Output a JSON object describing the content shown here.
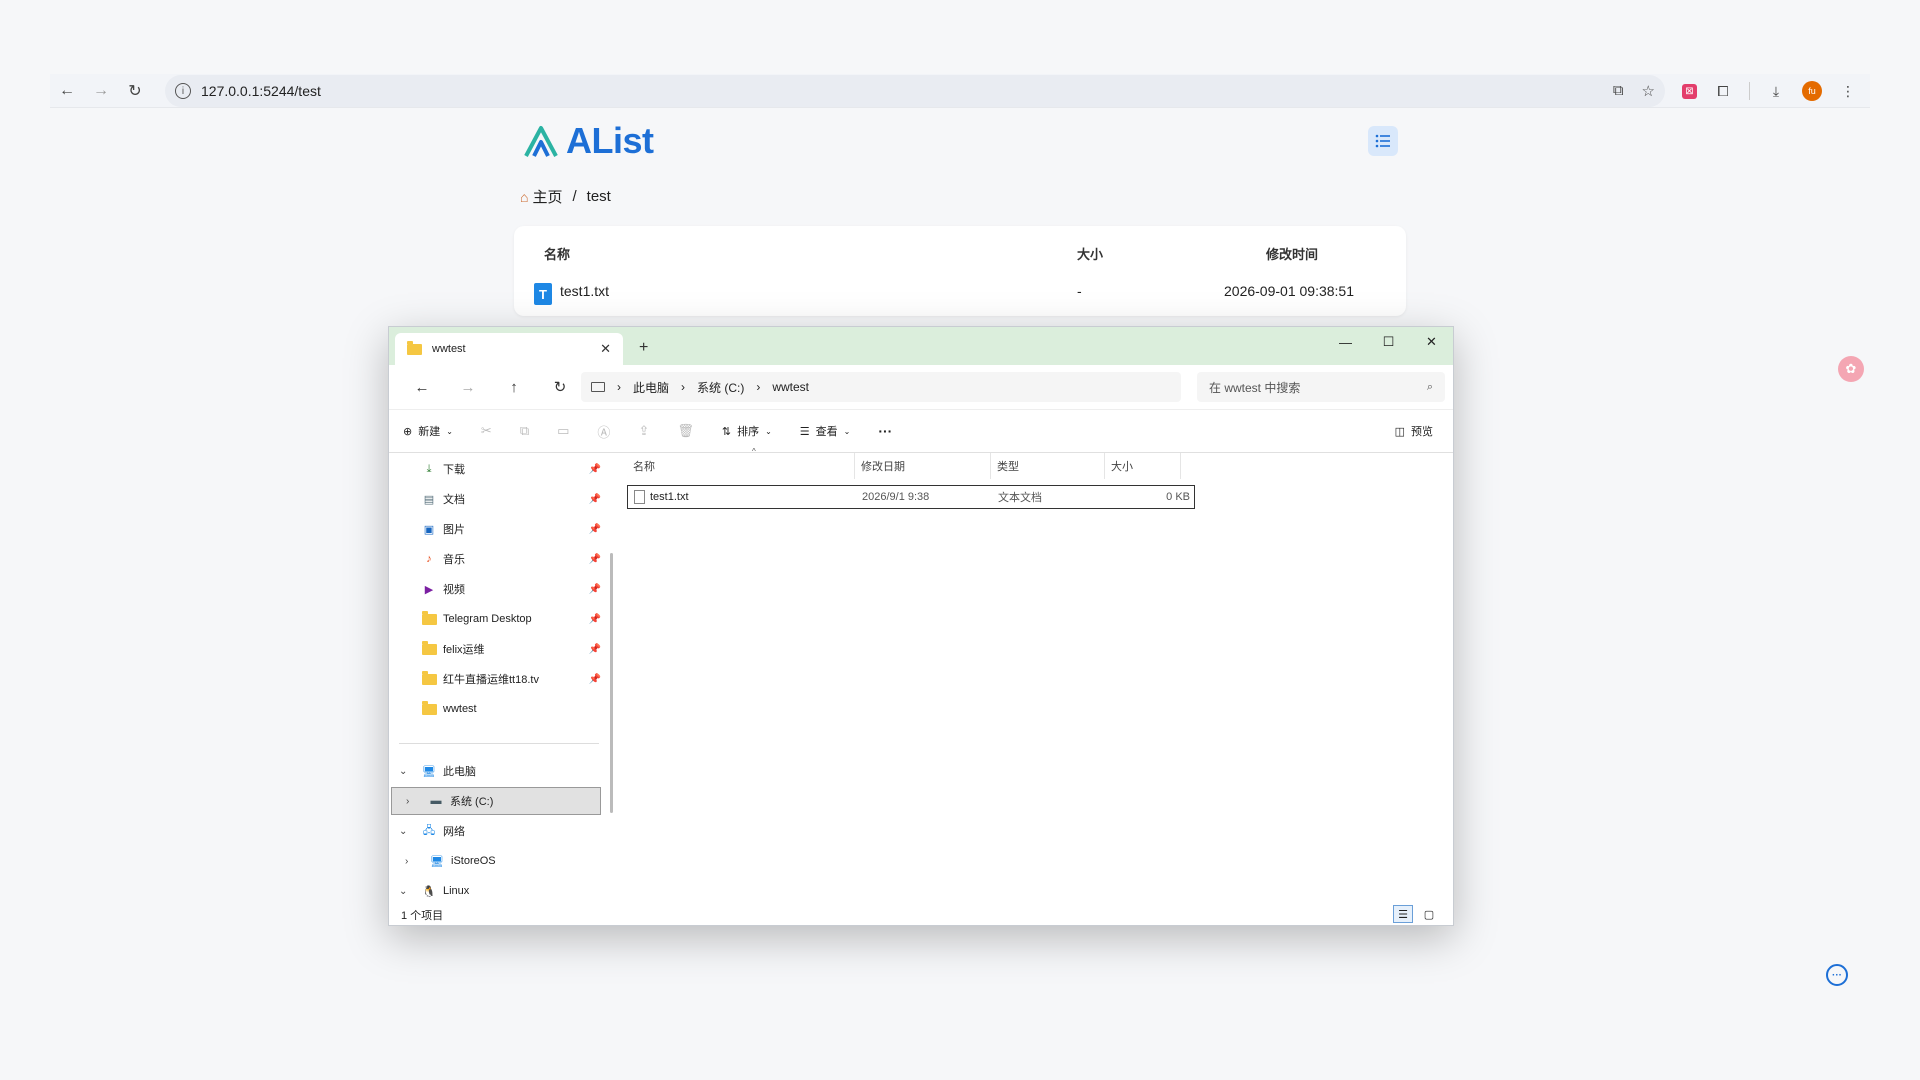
{
  "browser": {
    "url": "127.0.0.1:5244/test",
    "back_icon": "←",
    "forward_icon": "→",
    "reload_icon": "↻",
    "profile_initial": "fu"
  },
  "alist": {
    "brand": "AList",
    "breadcrumb": {
      "home": "主页",
      "separator": "/",
      "current": "test"
    },
    "table": {
      "headers": {
        "name": "名称",
        "size": "大小",
        "modified": "修改时间"
      },
      "rows": [
        {
          "name": "test1.txt",
          "size": "-",
          "modified": "2026-09-01 09:38:51"
        }
      ]
    },
    "accent_color": "#1d6fd6"
  },
  "explorer": {
    "tab_title": "wwtest",
    "new_tab": "+",
    "window_controls": {
      "minimize": "—",
      "maximize": "☐",
      "close": "✕"
    },
    "address": {
      "segments": [
        "此电脑",
        "系统 (C:)",
        "wwtest"
      ],
      "separator": "›"
    },
    "search_placeholder": "在 wwtest 中搜索",
    "commands": {
      "new": "新建",
      "sort": "排序",
      "view": "查看",
      "more": "···",
      "preview": "预览"
    },
    "nav_quick": [
      {
        "label": "下载",
        "icon": "download-icon"
      },
      {
        "label": "文档",
        "icon": "document-icon"
      },
      {
        "label": "图片",
        "icon": "picture-icon"
      },
      {
        "label": "音乐",
        "icon": "music-icon"
      },
      {
        "label": "视频",
        "icon": "video-icon"
      },
      {
        "label": "Telegram Desktop",
        "icon": "folder-icon"
      },
      {
        "label": "felix运维",
        "icon": "folder-icon"
      },
      {
        "label": "红牛直播运维tt18.tv",
        "icon": "folder-icon"
      },
      {
        "label": "wwtest",
        "icon": "folder-icon"
      }
    ],
    "nav_tree": [
      {
        "label": "此电脑",
        "expanded": true
      },
      {
        "label": "系统 (C:)",
        "selected": true
      },
      {
        "label": "网络",
        "expanded": true
      },
      {
        "label": "iStoreOS"
      },
      {
        "label": "Linux",
        "expanded": true
      }
    ],
    "columns": {
      "name": "名称",
      "date": "修改日期",
      "type": "类型",
      "size": "大小"
    },
    "files": [
      {
        "name": "test1.txt",
        "date": "2026/9/1 9:38",
        "type": "文本文档",
        "size": "0 KB"
      }
    ],
    "status": "1 个项目"
  }
}
